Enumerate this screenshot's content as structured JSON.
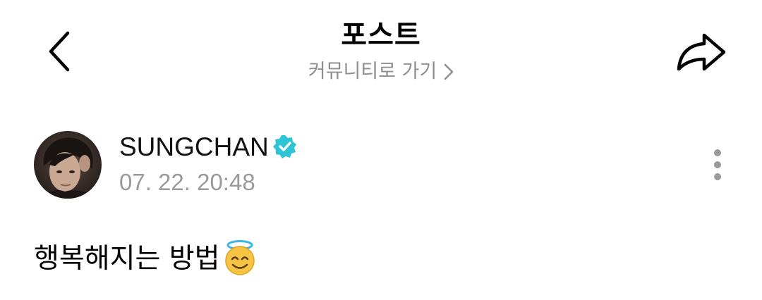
{
  "header": {
    "title": "포스트",
    "community_link_label": "커뮤니티로 가기",
    "back_icon": "chevron-left-icon",
    "share_icon": "share-arrow-icon",
    "link_icon": "chevron-right-icon"
  },
  "post": {
    "author_name": "SUNGCHAN",
    "verified_icon": "verified-badge-icon",
    "verified_color": "#2ec4d6",
    "timestamp": "07. 22. 20:48",
    "text": "행복해지는 방법",
    "emoji": "smiling-face-with-halo",
    "more_icon": "vertical-dots-icon"
  }
}
